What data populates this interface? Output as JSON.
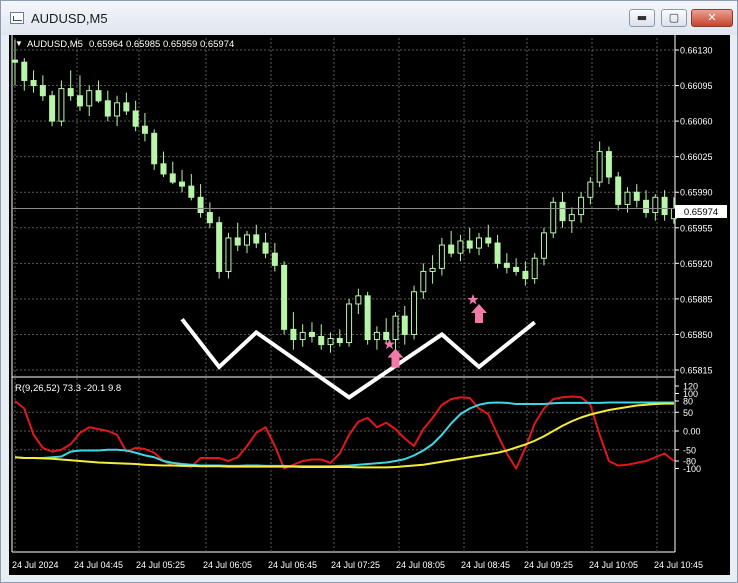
{
  "window": {
    "title": "AUDUSD,M5",
    "minimize_glyph": "▬",
    "maximize_glyph": "▢",
    "close_glyph": "✕"
  },
  "price_chart": {
    "symbol_label": "AUDUSD,M5",
    "ohlc": "0.65964 0.65985 0.65959 0.65974",
    "current_price": "0.65974",
    "y_ticks": [
      "0.66130",
      "0.66095",
      "0.66060",
      "0.66025",
      "0.65990",
      "0.65955",
      "0.65920",
      "0.65885",
      "0.65850",
      "0.65815"
    ]
  },
  "indicator": {
    "label": "R(9,26,52) 73.3 -20.1 9.8",
    "y_ticks": [
      "120",
      "100",
      "80",
      "50",
      "0.00",
      "-50",
      "-80",
      "-100"
    ]
  },
  "time_axis": [
    "24 Jul 2024",
    "24 Jul 04:45",
    "24 Jul 05:25",
    "24 Jul 06:05",
    "24 Jul 06:45",
    "24 Jul 07:25",
    "24 Jul 08:05",
    "24 Jul 08:45",
    "24 Jul 09:25",
    "24 Jul 10:05",
    "24 Jul 10:45"
  ],
  "colors": {
    "background": "#000000",
    "grid": "#5a5a5a",
    "candle": "#b7f5a8",
    "red_line": "#e01818",
    "cyan_line": "#3fd6e6",
    "yellow_line": "#f2ec3a",
    "zigzag": "#ffffff",
    "signal_arrow": "#f27aa8"
  },
  "chart_data": {
    "type": "candlestick",
    "x_unit": "bar index (5-minute bars from 24 Jul 04:05)",
    "candles": [
      [
        0,
        0.6612,
        0.6614,
        0.66095,
        0.66118
      ],
      [
        1,
        0.66118,
        0.66122,
        0.6609,
        0.661
      ],
      [
        2,
        0.661,
        0.6611,
        0.66088,
        0.66095
      ],
      [
        3,
        0.66095,
        0.66105,
        0.6608,
        0.66085
      ],
      [
        4,
        0.66085,
        0.6609,
        0.66055,
        0.6606
      ],
      [
        5,
        0.6606,
        0.661,
        0.66055,
        0.66092
      ],
      [
        6,
        0.66092,
        0.6611,
        0.6608,
        0.66085
      ],
      [
        7,
        0.66085,
        0.66105,
        0.6607,
        0.66075
      ],
      [
        8,
        0.66075,
        0.66095,
        0.66065,
        0.6609
      ],
      [
        9,
        0.6609,
        0.661,
        0.66078,
        0.6608
      ],
      [
        10,
        0.6608,
        0.6609,
        0.6606,
        0.66065
      ],
      [
        11,
        0.66065,
        0.66085,
        0.66055,
        0.66078
      ],
      [
        12,
        0.66078,
        0.66088,
        0.66066,
        0.6607
      ],
      [
        13,
        0.6607,
        0.6608,
        0.6605,
        0.66055
      ],
      [
        14,
        0.66055,
        0.66068,
        0.6604,
        0.66048
      ],
      [
        15,
        0.66048,
        0.66052,
        0.66012,
        0.66018
      ],
      [
        16,
        0.66018,
        0.6603,
        0.66005,
        0.66008
      ],
      [
        17,
        0.66008,
        0.6602,
        0.65998,
        0.66
      ],
      [
        18,
        0.66,
        0.66012,
        0.6599,
        0.65996
      ],
      [
        19,
        0.65996,
        0.66008,
        0.65982,
        0.65985
      ],
      [
        20,
        0.65985,
        0.65998,
        0.65965,
        0.6597
      ],
      [
        21,
        0.6597,
        0.6598,
        0.65955,
        0.6596
      ],
      [
        22,
        0.6596,
        0.65966,
        0.65905,
        0.65912
      ],
      [
        23,
        0.65912,
        0.6595,
        0.65905,
        0.65945
      ],
      [
        24,
        0.65945,
        0.6596,
        0.65932,
        0.65938
      ],
      [
        25,
        0.65938,
        0.65952,
        0.6593,
        0.65948
      ],
      [
        26,
        0.65948,
        0.65958,
        0.65935,
        0.6594
      ],
      [
        27,
        0.6594,
        0.6595,
        0.65925,
        0.6593
      ],
      [
        28,
        0.6593,
        0.6594,
        0.65912,
        0.65918
      ],
      [
        29,
        0.65918,
        0.65922,
        0.6585,
        0.65855
      ],
      [
        30,
        0.65855,
        0.65872,
        0.65835,
        0.65845
      ],
      [
        31,
        0.65845,
        0.6586,
        0.65838,
        0.65852
      ],
      [
        32,
        0.65852,
        0.65862,
        0.65842,
        0.65848
      ],
      [
        33,
        0.65848,
        0.6586,
        0.65835,
        0.6584
      ],
      [
        34,
        0.6584,
        0.65852,
        0.65832,
        0.65846
      ],
      [
        35,
        0.65846,
        0.65855,
        0.65838,
        0.65842
      ],
      [
        36,
        0.65842,
        0.65885,
        0.65838,
        0.6588
      ],
      [
        37,
        0.6588,
        0.65895,
        0.6587,
        0.65888
      ],
      [
        38,
        0.65888,
        0.65892,
        0.6584,
        0.65845
      ],
      [
        39,
        0.65845,
        0.65858,
        0.65835,
        0.65852
      ],
      [
        40,
        0.65852,
        0.65866,
        0.6584,
        0.65845
      ],
      [
        41,
        0.65845,
        0.65872,
        0.65835,
        0.65868
      ],
      [
        42,
        0.65868,
        0.65878,
        0.6584,
        0.6585
      ],
      [
        43,
        0.6585,
        0.65898,
        0.65845,
        0.65892
      ],
      [
        44,
        0.65892,
        0.6592,
        0.65885,
        0.65912
      ],
      [
        45,
        0.65912,
        0.65928,
        0.659,
        0.65915
      ],
      [
        46,
        0.65915,
        0.65945,
        0.65908,
        0.65938
      ],
      [
        47,
        0.65938,
        0.65952,
        0.65926,
        0.6593
      ],
      [
        48,
        0.6593,
        0.65948,
        0.65922,
        0.65942
      ],
      [
        49,
        0.65942,
        0.65955,
        0.6593,
        0.65935
      ],
      [
        50,
        0.65935,
        0.6595,
        0.65928,
        0.65945
      ],
      [
        51,
        0.65945,
        0.65958,
        0.65936,
        0.6594
      ],
      [
        52,
        0.6594,
        0.65948,
        0.65915,
        0.6592
      ],
      [
        53,
        0.6592,
        0.6593,
        0.6591,
        0.65916
      ],
      [
        54,
        0.65916,
        0.65925,
        0.65908,
        0.65912
      ],
      [
        55,
        0.65912,
        0.65922,
        0.65898,
        0.65905
      ],
      [
        56,
        0.65905,
        0.6593,
        0.659,
        0.65925
      ],
      [
        57,
        0.65925,
        0.65955,
        0.65918,
        0.6595
      ],
      [
        58,
        0.6595,
        0.65985,
        0.65945,
        0.6598
      ],
      [
        59,
        0.6598,
        0.6599,
        0.65955,
        0.65962
      ],
      [
        60,
        0.65962,
        0.65975,
        0.6595,
        0.65968
      ],
      [
        61,
        0.65968,
        0.6599,
        0.6596,
        0.65985
      ],
      [
        62,
        0.65985,
        0.66005,
        0.65978,
        0.66
      ],
      [
        63,
        0.66,
        0.6604,
        0.65995,
        0.6603
      ],
      [
        64,
        0.6603,
        0.66035,
        0.65998,
        0.66005
      ],
      [
        65,
        0.66005,
        0.6601,
        0.65972,
        0.65978
      ],
      [
        66,
        0.65978,
        0.65995,
        0.6597,
        0.6599
      ],
      [
        67,
        0.6599,
        0.65998,
        0.65975,
        0.65982
      ],
      [
        68,
        0.65982,
        0.65992,
        0.65965,
        0.6597
      ],
      [
        69,
        0.6597,
        0.65988,
        0.65962,
        0.65985
      ],
      [
        70,
        0.65985,
        0.65992,
        0.65962,
        0.65968
      ],
      [
        71,
        0.65964,
        0.65985,
        0.65959,
        0.65974
      ]
    ],
    "zigzag_points": [
      [
        18,
        0.65865
      ],
      [
        22,
        0.65818
      ],
      [
        26,
        0.65852
      ],
      [
        36,
        0.65788
      ],
      [
        46,
        0.6585
      ],
      [
        50,
        0.65818
      ],
      [
        56,
        0.65862
      ]
    ],
    "signals": [
      [
        41,
        0.65836,
        "buy"
      ],
      [
        50,
        0.6588,
        "buy"
      ]
    ],
    "indicator": {
      "ylim": [
        -120,
        120
      ],
      "series": [
        {
          "values": [
            80,
            60,
            -10,
            -45,
            -55,
            -50,
            -35,
            -5,
            10,
            5,
            0,
            -10,
            -55,
            -45,
            -48,
            -58,
            -80,
            -92,
            -92,
            -95,
            -72,
            -72,
            -72,
            -80,
            -70,
            -40,
            -5,
            10,
            -40,
            -100,
            -90,
            -80,
            -76,
            -76,
            -85,
            -60,
            -10,
            25,
            35,
            10,
            22,
            5,
            -20,
            -40,
            5,
            35,
            70,
            85,
            90,
            88,
            60,
            45,
            -10,
            -60,
            -100,
            -45,
            20,
            60,
            85,
            90,
            92,
            90,
            70,
            -10,
            -80,
            -92,
            -90,
            -85,
            -80,
            -70,
            -60,
            -80
          ]
        },
        {
          "values": [
            -70,
            -72,
            -72,
            -72,
            -70,
            -68,
            -55,
            -52,
            -52,
            -52,
            -50,
            -50,
            -52,
            -58,
            -65,
            -70,
            -80,
            -85,
            -88,
            -90,
            -92,
            -92,
            -92,
            -93,
            -93,
            -92,
            -92,
            -93,
            -93,
            -93,
            -94,
            -94,
            -94,
            -94,
            -94,
            -93,
            -92,
            -90,
            -88,
            -86,
            -84,
            -80,
            -75,
            -65,
            -52,
            -35,
            -10,
            20,
            45,
            60,
            70,
            75,
            76,
            75,
            72,
            72,
            72,
            72,
            74,
            75,
            75,
            75,
            75,
            75,
            76,
            76,
            76,
            76,
            76,
            76,
            76,
            76
          ]
        },
        {
          "values": [
            -70,
            -72,
            -72,
            -73,
            -74,
            -76,
            -78,
            -80,
            -82,
            -84,
            -85,
            -86,
            -87,
            -88,
            -90,
            -91,
            -92,
            -92,
            -93,
            -93,
            -94,
            -94,
            -94,
            -95,
            -95,
            -95,
            -95,
            -95,
            -95,
            -95,
            -95,
            -96,
            -96,
            -96,
            -96,
            -96,
            -96,
            -97,
            -97,
            -97,
            -97,
            -96,
            -94,
            -92,
            -90,
            -86,
            -82,
            -78,
            -74,
            -70,
            -66,
            -62,
            -58,
            -52,
            -44,
            -36,
            -26,
            -14,
            0,
            14,
            26,
            36,
            44,
            50,
            56,
            60,
            64,
            68,
            70,
            72,
            73,
            73
          ]
        }
      ]
    }
  }
}
